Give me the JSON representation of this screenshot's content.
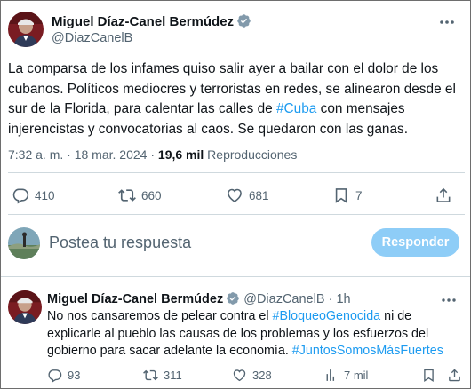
{
  "main_tweet": {
    "author_name": "Miguel Díaz-Canel Bermúdez",
    "author_handle": "@DiazCanelB",
    "text_parts": {
      "before_hashtag": "La comparsa de los infames quiso salir ayer a bailar con el dolor de los cubanos. Políticos mediocres y terroristas en redes, se alinearon desde el sur de la Florida, para calentar las calles de ",
      "hashtag": "#Cuba",
      "after_hashtag": " con mensajes injerencistas y convocatorias al caos. Se quedaron con las ganas."
    },
    "time": "7:32 a. m.",
    "separator": "·",
    "date": "18 mar. 2024",
    "views_count": "19,6 mil",
    "views_label": "Reproducciones",
    "counts": {
      "replies": "410",
      "reposts": "660",
      "likes": "681",
      "bookmarks": "7"
    }
  },
  "reply_box": {
    "placeholder": "Postea tu respuesta",
    "button_label": "Responder"
  },
  "reply_tweet": {
    "author_name": "Miguel Díaz-Canel Bermúdez",
    "author_handle": "@DiazCanelB",
    "dot": "·",
    "time": "1h",
    "text_parts": {
      "part1": "No nos cansaremos de pelear contra el ",
      "hashtag1": "#BloqueoGenocida",
      "part2": " ni de explicarle al pueblo las causas de los problemas y los esfuerzos del gobierno para sacar adelante la economía. ",
      "hashtag2": "#JuntosSomosMásFuertes"
    },
    "counts": {
      "replies": "93",
      "reposts": "311",
      "likes": "328",
      "views": "7 mil"
    }
  },
  "colors": {
    "accent": "#1d9bf0",
    "button_disabled": "#8ecdf7",
    "muted_text": "#536471",
    "divider": "#cfd9de",
    "verified_badge": "#829aab"
  }
}
